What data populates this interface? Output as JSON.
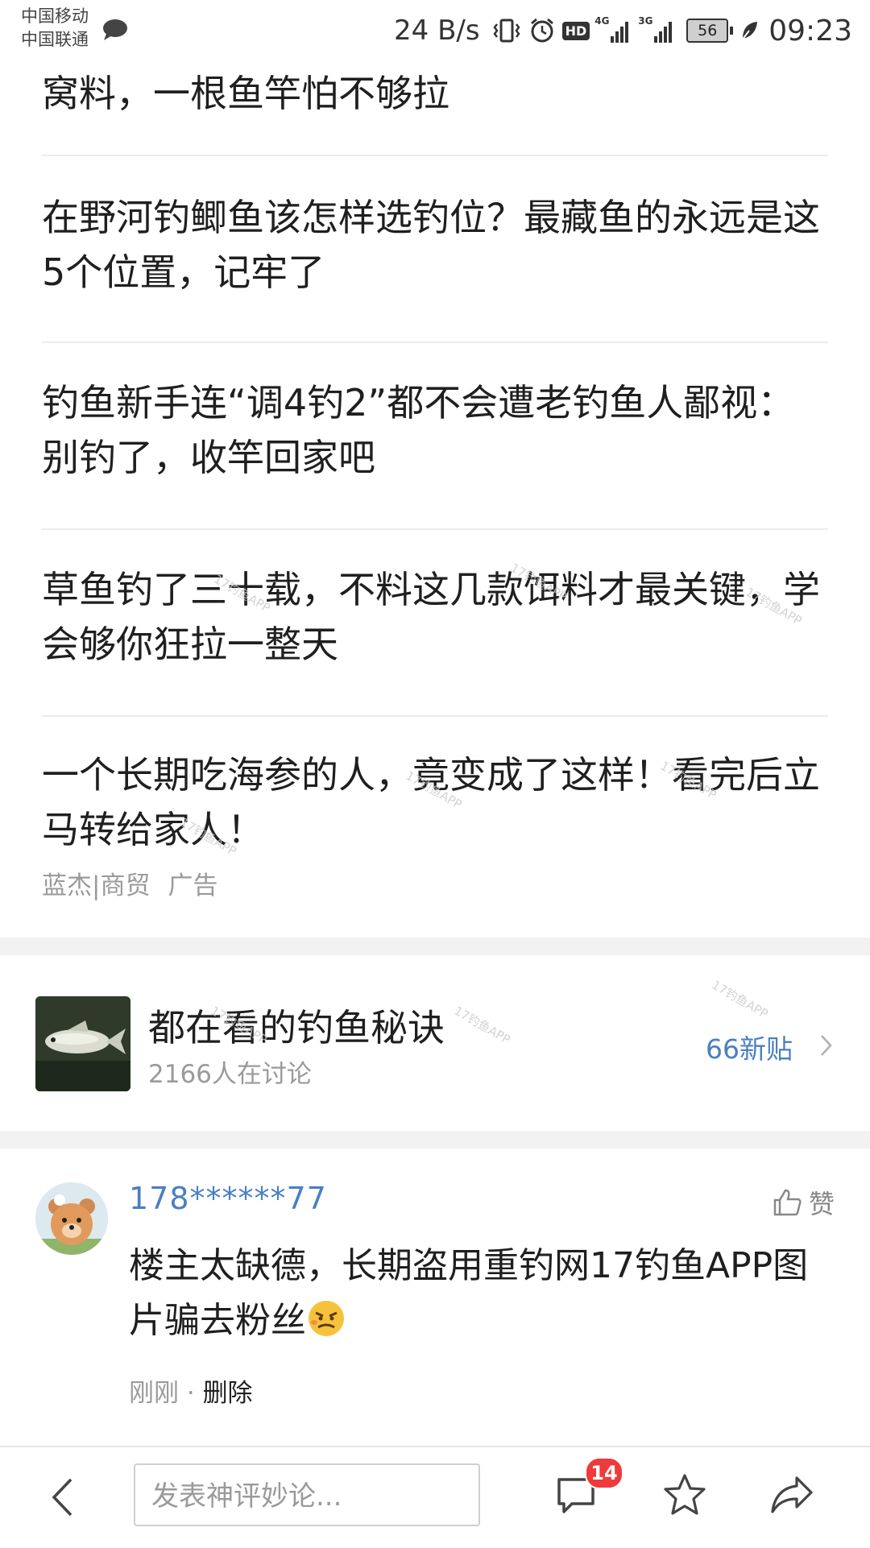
{
  "status_bar": {
    "carrier1": "中国移动",
    "carrier2": "中国联通",
    "net_speed": "24 B/s",
    "hd": "HD",
    "signal1_label": "4G",
    "signal2_label": "3G",
    "battery": "56",
    "time": "09:23"
  },
  "articles": [
    {
      "title": "窝料，一根鱼竿怕不够拉"
    },
    {
      "title": "在野河钓鲫鱼该怎样选钓位？最藏鱼的永远是这5个位置，记牢了"
    },
    {
      "title": "钓鱼新手连“调4钓2”都不会遭老钓鱼人鄙视：别钓了，收竿回家吧"
    },
    {
      "title": "草鱼钓了三十载，不料这几款饵料才最关键，学会够你狂拉一整天"
    },
    {
      "title": "一个长期吃海参的人，竟变成了这样！看完后立马转给家人！",
      "source": "蓝杰|商贸",
      "ad_label": "广告"
    }
  ],
  "topic": {
    "title": "都在看的钓鱼秘诀",
    "subtitle": "2166人在讨论",
    "new_posts": "66新贴"
  },
  "comment": {
    "user": "178******77",
    "like_label": "赞",
    "text": "楼主太缺德，长期盗用重钓网17钓鱼APP图片骗去粉丝",
    "time": "刚刚",
    "separator": " · ",
    "delete_label": "删除"
  },
  "bottom_bar": {
    "input_placeholder": "发表神评妙论...",
    "message_count": "14"
  },
  "watermark": {
    "text": "17钓鱼APP"
  },
  "colors": {
    "link_blue": "#4a7fc1",
    "badge_red": "#ee3a3a",
    "divider": "#ececec",
    "section_gap": "#f2f2f2"
  }
}
